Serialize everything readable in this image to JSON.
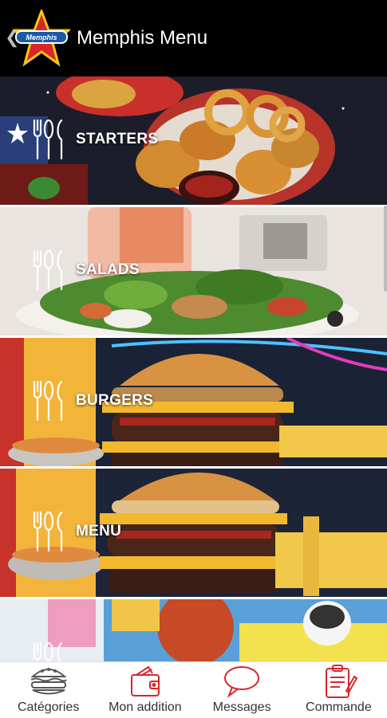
{
  "header": {
    "back_icon": "chevron-left-icon",
    "logo_text": "Memphis",
    "title": "Memphis Menu"
  },
  "categories": [
    {
      "label": "STARTERS",
      "icon": "cutlery-icon"
    },
    {
      "label": "SALADS",
      "icon": "cutlery-icon"
    },
    {
      "label": "BURGERS",
      "icon": "cutlery-icon"
    },
    {
      "label": "MENU",
      "icon": "cutlery-icon"
    },
    {
      "label": "",
      "icon": "cutlery-icon"
    }
  ],
  "tabs": [
    {
      "label": "Catégories",
      "icon": "burger-icon"
    },
    {
      "label": "Mon addition",
      "icon": "wallet-icon"
    },
    {
      "label": "Messages",
      "icon": "speech-bubble-icon"
    },
    {
      "label": "Commande",
      "icon": "clipboard-icon"
    }
  ],
  "colors": {
    "accent_red": "#d8262b",
    "logo_blue": "#1b5aa6",
    "logo_yellow": "#f5c518",
    "header_bg": "#000000"
  }
}
